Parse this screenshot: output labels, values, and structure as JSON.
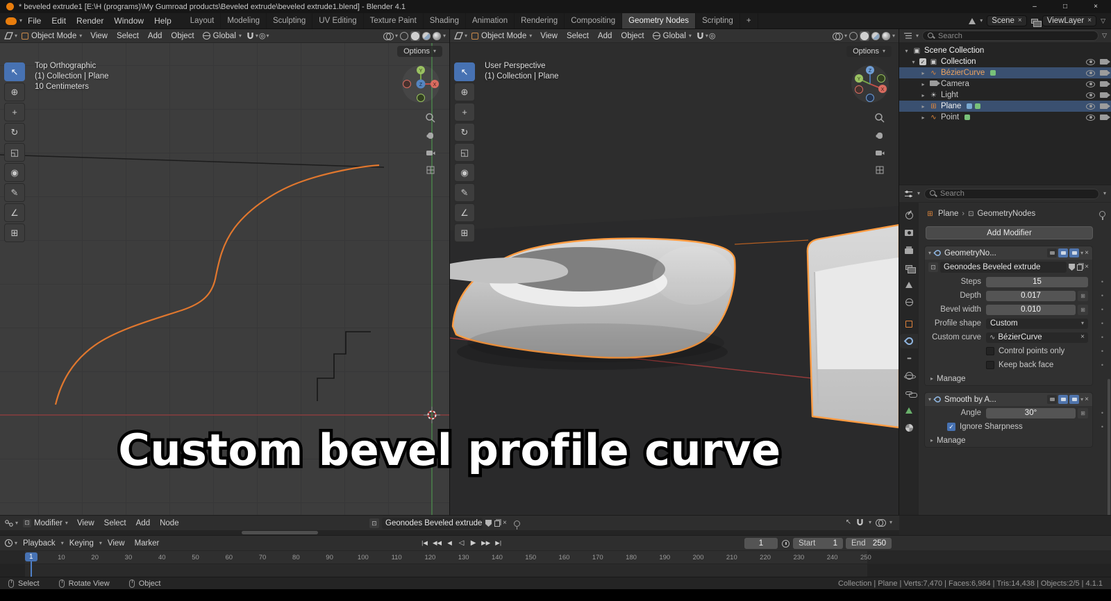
{
  "titlebar": {
    "title": "* beveled extrude1 [E:\\H (programs)\\My Gumroad products\\Beveled extrude\\beveled extrude1.blend] - Blender 4.1"
  },
  "menubar": {
    "menus": [
      "File",
      "Edit",
      "Render",
      "Window",
      "Help"
    ],
    "workspaces": [
      "Layout",
      "Modeling",
      "Sculpting",
      "UV Editing",
      "Texture Paint",
      "Shading",
      "Animation",
      "Rendering",
      "Compositing",
      "Geometry Nodes",
      "Scripting"
    ],
    "new_workspace": "+",
    "scene_name": "Scene",
    "view_layer_name": "ViewLayer"
  },
  "viewport_left": {
    "mode": "Object Mode",
    "menu_view": "View",
    "menu_select": "Select",
    "menu_add": "Add",
    "menu_object": "Object",
    "orientation": "Global",
    "options_label": "Options",
    "overlay_line1": "Top Orthographic",
    "overlay_line2": "(1) Collection | Plane",
    "overlay_line3": "10 Centimeters"
  },
  "viewport_right": {
    "mode": "Object Mode",
    "menu_view": "View",
    "menu_select": "Select",
    "menu_add": "Add",
    "menu_object": "Object",
    "orientation": "Global",
    "options_label": "Options",
    "overlay_line1": "User Perspective",
    "overlay_line2": "(1) Collection | Plane"
  },
  "outliner": {
    "search_placeholder": "Search",
    "scene_collection": "Scene Collection",
    "collection": "Collection",
    "items": [
      {
        "name": "BézierCurve"
      },
      {
        "name": "Camera"
      },
      {
        "name": "Light"
      },
      {
        "name": "Plane"
      },
      {
        "name": "Point"
      }
    ]
  },
  "properties": {
    "search_placeholder": "Search",
    "breadcrumb_object": "Plane",
    "breadcrumb_tree": "GeometryNodes",
    "add_modifier": "Add Modifier",
    "mod1": {
      "name": "GeometryNo...",
      "node_group": "Geonodes Beveled extrude",
      "steps_label": "Steps",
      "steps_value": "15",
      "depth_label": "Depth",
      "depth_value": "0.017",
      "bevel_label": "Bevel width",
      "bevel_value": "0.010",
      "profile_label": "Profile shape",
      "profile_value": "Custom",
      "curve_label": "Custom curve",
      "curve_value": "BézierCurve",
      "checkbox_control": "Control points only",
      "checkbox_backface": "Keep back face",
      "manage": "Manage"
    },
    "mod2": {
      "name": "Smooth by A...",
      "angle_label": "Angle",
      "angle_value": "30°",
      "checkbox_sharpness": "Ignore Sharpness",
      "manage": "Manage"
    }
  },
  "node_editor": {
    "mode": "Modifier",
    "menu_view": "View",
    "menu_select": "Select",
    "menu_add": "Add",
    "menu_node": "Node",
    "node_group": "Geonodes Beveled extrude"
  },
  "timeline": {
    "menu_playback": "Playback",
    "menu_keying": "Keying",
    "menu_view": "View",
    "menu_marker": "Marker",
    "playback_buttons": [
      "|◀",
      "◀◀",
      "◀",
      "◁",
      "▶",
      "▶▶",
      "▶|"
    ],
    "frame_field": "1",
    "current_frame": "1",
    "start_label": "Start",
    "start_value": "1",
    "end_label": "End",
    "end_value": "250",
    "ruler_step": 10,
    "ruler_max": 250
  },
  "statusbar": {
    "hint_select": "Select",
    "hint_rotate": "Rotate View",
    "hint_object": "Object",
    "stats": "Collection | Plane | Verts:7,470 | Faces:6,984 | Tris:14,438 | Objects:2/5 | 4.1.1"
  },
  "caption": "Custom bevel profile curve",
  "icons": {
    "chevron_down": "▾",
    "chevron_right": "▸",
    "close": "×",
    "dot": "•",
    "check": "✓",
    "minimize": "–",
    "maximize": "□",
    "select_tool": "↖",
    "cursor_tool": "⊕",
    "move_tool": "+",
    "rotate_tool": "↻",
    "scale_tool": "◱",
    "transform_tool": "◉",
    "annotate_tool": "✎",
    "measure_tool": "∠",
    "add_cube_tool": "⊞",
    "proportional": "◎",
    "curve": "∿",
    "light": "☀",
    "mesh": "⊞",
    "collection": "▣",
    "point": "∿",
    "funnel": "▽",
    "node_tree": "⊡",
    "breadcrumb_sep": "›",
    "grid_icon": "⊞"
  }
}
